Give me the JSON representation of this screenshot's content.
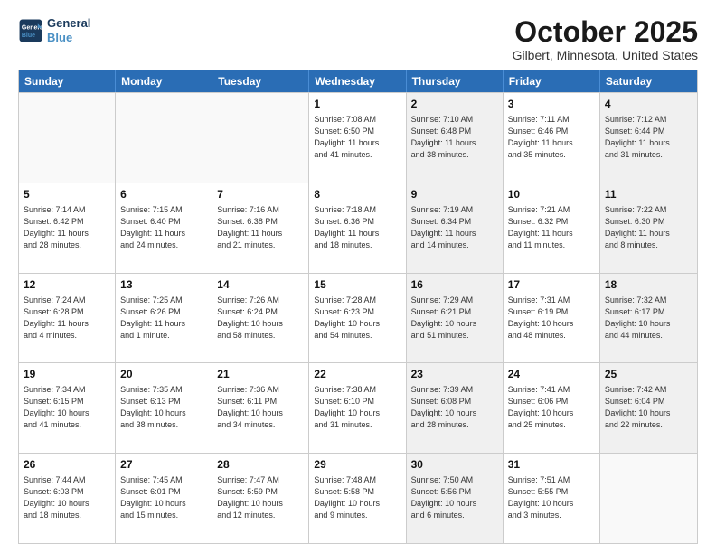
{
  "logo": {
    "line1": "General",
    "line2": "Blue"
  },
  "title": "October 2025",
  "location": "Gilbert, Minnesota, United States",
  "header_days": [
    "Sunday",
    "Monday",
    "Tuesday",
    "Wednesday",
    "Thursday",
    "Friday",
    "Saturday"
  ],
  "weeks": [
    [
      {
        "day": "",
        "text": "",
        "empty": true,
        "shaded": false
      },
      {
        "day": "",
        "text": "",
        "empty": true,
        "shaded": false
      },
      {
        "day": "",
        "text": "",
        "empty": true,
        "shaded": false
      },
      {
        "day": "1",
        "text": "Sunrise: 7:08 AM\nSunset: 6:50 PM\nDaylight: 11 hours\nand 41 minutes.",
        "empty": false,
        "shaded": false
      },
      {
        "day": "2",
        "text": "Sunrise: 7:10 AM\nSunset: 6:48 PM\nDaylight: 11 hours\nand 38 minutes.",
        "empty": false,
        "shaded": true
      },
      {
        "day": "3",
        "text": "Sunrise: 7:11 AM\nSunset: 6:46 PM\nDaylight: 11 hours\nand 35 minutes.",
        "empty": false,
        "shaded": false
      },
      {
        "day": "4",
        "text": "Sunrise: 7:12 AM\nSunset: 6:44 PM\nDaylight: 11 hours\nand 31 minutes.",
        "empty": false,
        "shaded": true
      }
    ],
    [
      {
        "day": "5",
        "text": "Sunrise: 7:14 AM\nSunset: 6:42 PM\nDaylight: 11 hours\nand 28 minutes.",
        "empty": false,
        "shaded": false
      },
      {
        "day": "6",
        "text": "Sunrise: 7:15 AM\nSunset: 6:40 PM\nDaylight: 11 hours\nand 24 minutes.",
        "empty": false,
        "shaded": false
      },
      {
        "day": "7",
        "text": "Sunrise: 7:16 AM\nSunset: 6:38 PM\nDaylight: 11 hours\nand 21 minutes.",
        "empty": false,
        "shaded": false
      },
      {
        "day": "8",
        "text": "Sunrise: 7:18 AM\nSunset: 6:36 PM\nDaylight: 11 hours\nand 18 minutes.",
        "empty": false,
        "shaded": false
      },
      {
        "day": "9",
        "text": "Sunrise: 7:19 AM\nSunset: 6:34 PM\nDaylight: 11 hours\nand 14 minutes.",
        "empty": false,
        "shaded": true
      },
      {
        "day": "10",
        "text": "Sunrise: 7:21 AM\nSunset: 6:32 PM\nDaylight: 11 hours\nand 11 minutes.",
        "empty": false,
        "shaded": false
      },
      {
        "day": "11",
        "text": "Sunrise: 7:22 AM\nSunset: 6:30 PM\nDaylight: 11 hours\nand 8 minutes.",
        "empty": false,
        "shaded": true
      }
    ],
    [
      {
        "day": "12",
        "text": "Sunrise: 7:24 AM\nSunset: 6:28 PM\nDaylight: 11 hours\nand 4 minutes.",
        "empty": false,
        "shaded": false
      },
      {
        "day": "13",
        "text": "Sunrise: 7:25 AM\nSunset: 6:26 PM\nDaylight: 11 hours\nand 1 minute.",
        "empty": false,
        "shaded": false
      },
      {
        "day": "14",
        "text": "Sunrise: 7:26 AM\nSunset: 6:24 PM\nDaylight: 10 hours\nand 58 minutes.",
        "empty": false,
        "shaded": false
      },
      {
        "day": "15",
        "text": "Sunrise: 7:28 AM\nSunset: 6:23 PM\nDaylight: 10 hours\nand 54 minutes.",
        "empty": false,
        "shaded": false
      },
      {
        "day": "16",
        "text": "Sunrise: 7:29 AM\nSunset: 6:21 PM\nDaylight: 10 hours\nand 51 minutes.",
        "empty": false,
        "shaded": true
      },
      {
        "day": "17",
        "text": "Sunrise: 7:31 AM\nSunset: 6:19 PM\nDaylight: 10 hours\nand 48 minutes.",
        "empty": false,
        "shaded": false
      },
      {
        "day": "18",
        "text": "Sunrise: 7:32 AM\nSunset: 6:17 PM\nDaylight: 10 hours\nand 44 minutes.",
        "empty": false,
        "shaded": true
      }
    ],
    [
      {
        "day": "19",
        "text": "Sunrise: 7:34 AM\nSunset: 6:15 PM\nDaylight: 10 hours\nand 41 minutes.",
        "empty": false,
        "shaded": false
      },
      {
        "day": "20",
        "text": "Sunrise: 7:35 AM\nSunset: 6:13 PM\nDaylight: 10 hours\nand 38 minutes.",
        "empty": false,
        "shaded": false
      },
      {
        "day": "21",
        "text": "Sunrise: 7:36 AM\nSunset: 6:11 PM\nDaylight: 10 hours\nand 34 minutes.",
        "empty": false,
        "shaded": false
      },
      {
        "day": "22",
        "text": "Sunrise: 7:38 AM\nSunset: 6:10 PM\nDaylight: 10 hours\nand 31 minutes.",
        "empty": false,
        "shaded": false
      },
      {
        "day": "23",
        "text": "Sunrise: 7:39 AM\nSunset: 6:08 PM\nDaylight: 10 hours\nand 28 minutes.",
        "empty": false,
        "shaded": true
      },
      {
        "day": "24",
        "text": "Sunrise: 7:41 AM\nSunset: 6:06 PM\nDaylight: 10 hours\nand 25 minutes.",
        "empty": false,
        "shaded": false
      },
      {
        "day": "25",
        "text": "Sunrise: 7:42 AM\nSunset: 6:04 PM\nDaylight: 10 hours\nand 22 minutes.",
        "empty": false,
        "shaded": true
      }
    ],
    [
      {
        "day": "26",
        "text": "Sunrise: 7:44 AM\nSunset: 6:03 PM\nDaylight: 10 hours\nand 18 minutes.",
        "empty": false,
        "shaded": false
      },
      {
        "day": "27",
        "text": "Sunrise: 7:45 AM\nSunset: 6:01 PM\nDaylight: 10 hours\nand 15 minutes.",
        "empty": false,
        "shaded": false
      },
      {
        "day": "28",
        "text": "Sunrise: 7:47 AM\nSunset: 5:59 PM\nDaylight: 10 hours\nand 12 minutes.",
        "empty": false,
        "shaded": false
      },
      {
        "day": "29",
        "text": "Sunrise: 7:48 AM\nSunset: 5:58 PM\nDaylight: 10 hours\nand 9 minutes.",
        "empty": false,
        "shaded": false
      },
      {
        "day": "30",
        "text": "Sunrise: 7:50 AM\nSunset: 5:56 PM\nDaylight: 10 hours\nand 6 minutes.",
        "empty": false,
        "shaded": true
      },
      {
        "day": "31",
        "text": "Sunrise: 7:51 AM\nSunset: 5:55 PM\nDaylight: 10 hours\nand 3 minutes.",
        "empty": false,
        "shaded": false
      },
      {
        "day": "",
        "text": "",
        "empty": true,
        "shaded": true
      }
    ]
  ]
}
